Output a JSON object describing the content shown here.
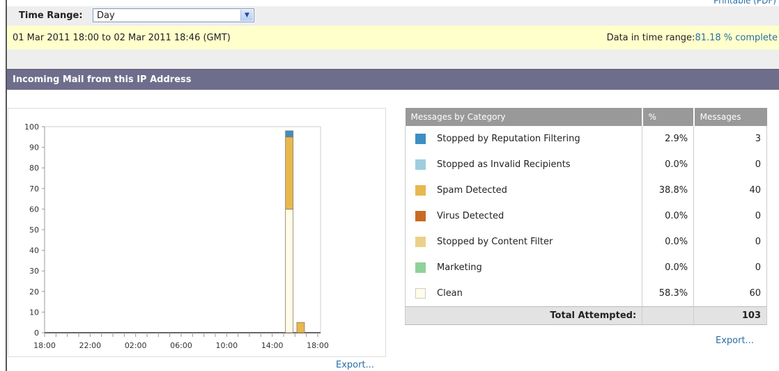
{
  "printable_link": "Printable (PDF)",
  "time_range": {
    "label": "Time Range:",
    "selected": "Day"
  },
  "range_info": {
    "period": "01 Mar 2011 18:00 to 02 Mar 2011 18:46 (GMT)",
    "data_label": "Data in time range:",
    "completeness": "81.18 % complete"
  },
  "section": {
    "title": "Incoming Mail from this IP Address"
  },
  "chart_data": {
    "type": "bar",
    "stacked": true,
    "xlabel": "",
    "ylabel": "",
    "ylim": [
      0,
      100
    ],
    "yticks": [
      0,
      10,
      20,
      30,
      40,
      50,
      60,
      70,
      80,
      90,
      100
    ],
    "xtick_labels": [
      "18:00",
      "22:00",
      "02:00",
      "06:00",
      "10:00",
      "14:00",
      "18:00"
    ],
    "hours": 25,
    "series": [
      {
        "name": "Clean",
        "color": "#fffce8",
        "values": [
          0,
          0,
          0,
          0,
          0,
          0,
          0,
          0,
          0,
          0,
          0,
          0,
          0,
          0,
          0,
          0,
          0,
          0,
          0,
          0,
          0,
          60,
          0,
          0,
          0
        ]
      },
      {
        "name": "Spam Detected",
        "color": "#e6b84f",
        "values": [
          0,
          0,
          0,
          0,
          0,
          0,
          0,
          0,
          0,
          0,
          0,
          0,
          0,
          0,
          0,
          0,
          0,
          0,
          0,
          0,
          0,
          35,
          5,
          0,
          0
        ]
      },
      {
        "name": "Stopped by Reputation Filtering",
        "color": "#3d8ec3",
        "values": [
          0,
          0,
          0,
          0,
          0,
          0,
          0,
          0,
          0,
          0,
          0,
          0,
          0,
          0,
          0,
          0,
          0,
          0,
          0,
          0,
          0,
          3,
          0,
          0,
          0
        ]
      }
    ],
    "grid": false,
    "legend": "none"
  },
  "chart_export": "Export...",
  "table": {
    "headers": [
      "Messages by Category",
      "%",
      "Messages"
    ],
    "rows": [
      {
        "category": "Stopped by Reputation Filtering",
        "color": "#3d8ec3",
        "percent": "2.9%",
        "messages": "3"
      },
      {
        "category": "Stopped as Invalid Recipients",
        "color": "#9fcde0",
        "percent": "0.0%",
        "messages": "0"
      },
      {
        "category": "Spam Detected",
        "color": "#e6b84f",
        "percent": "38.8%",
        "messages": "40"
      },
      {
        "category": "Virus Detected",
        "color": "#c86b24",
        "percent": "0.0%",
        "messages": "0"
      },
      {
        "category": "Stopped by Content Filter",
        "color": "#ecd08a",
        "percent": "0.0%",
        "messages": "0"
      },
      {
        "category": "Marketing",
        "color": "#8fd19a",
        "percent": "0.0%",
        "messages": "0"
      },
      {
        "category": "Clean",
        "color": "#fffce8",
        "percent": "58.3%",
        "messages": "60"
      }
    ],
    "total_label": "Total Attempted:",
    "total_percent": "",
    "total_messages": "103"
  },
  "table_export": "Export..."
}
